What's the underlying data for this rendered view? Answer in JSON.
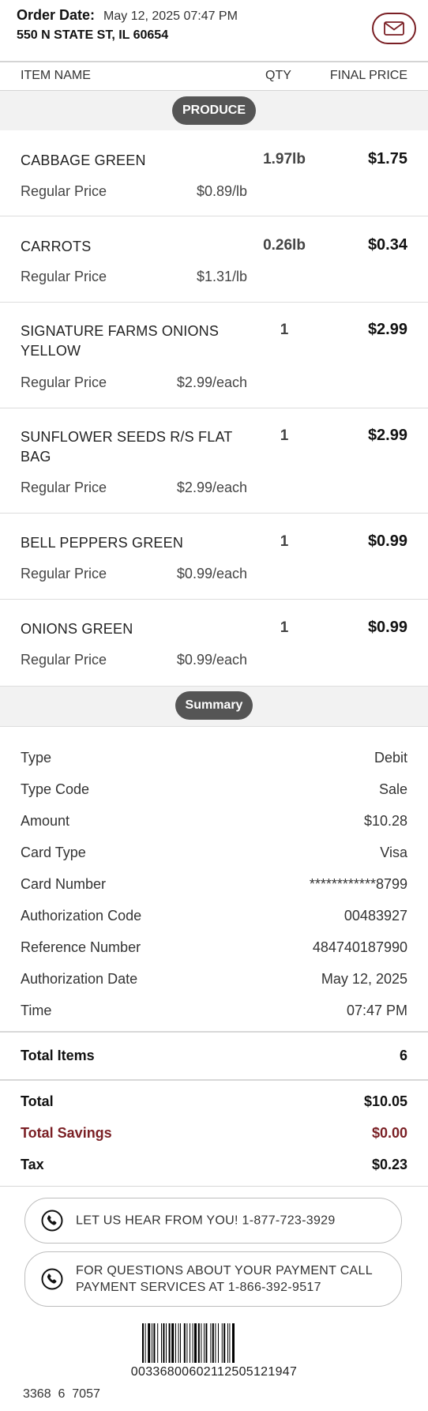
{
  "header": {
    "order_date_label": "Order Date:",
    "order_date_value": "May 12, 2025 07:47 PM",
    "address": "550 N STATE ST, IL 60654",
    "mail_icon": "envelope-icon",
    "accent_color": "#7a1f24"
  },
  "columns": {
    "item_name": "ITEM NAME",
    "qty": "QTY",
    "final_price": "FINAL PRICE"
  },
  "category": {
    "label": "PRODUCE"
  },
  "items": [
    {
      "name": "CABBAGE GREEN",
      "qty": "1.97lb",
      "price": "$1.75",
      "reg_label": "Regular Price",
      "reg_value": "$0.89/lb"
    },
    {
      "name": "CARROTS",
      "qty": "0.26lb",
      "price": "$0.34",
      "reg_label": "Regular Price",
      "reg_value": "$1.31/lb"
    },
    {
      "name": "SIGNATURE FARMS ONIONS YELLOW",
      "qty": "1",
      "price": "$2.99",
      "reg_label": "Regular Price",
      "reg_value": "$2.99/each"
    },
    {
      "name": "SUNFLOWER SEEDS R/S FLAT BAG",
      "qty": "1",
      "price": "$2.99",
      "reg_label": "Regular Price",
      "reg_value": "$2.99/each"
    },
    {
      "name": "BELL PEPPERS GREEN",
      "qty": "1",
      "price": "$0.99",
      "reg_label": "Regular Price",
      "reg_value": "$0.99/each"
    },
    {
      "name": "ONIONS GREEN",
      "qty": "1",
      "price": "$0.99",
      "reg_label": "Regular Price",
      "reg_value": "$0.99/each"
    }
  ],
  "summary": {
    "label": "Summary",
    "rows": [
      {
        "label": "Type",
        "value": "Debit"
      },
      {
        "label": "Type Code",
        "value": "Sale"
      },
      {
        "label": "Amount",
        "value": "$10.28"
      },
      {
        "label": "Card Type",
        "value": "Visa"
      },
      {
        "label": "Card Number",
        "value": "************8799"
      },
      {
        "label": "Authorization Code",
        "value": "00483927"
      },
      {
        "label": "Reference Number",
        "value": "484740187990"
      },
      {
        "label": "Authorization Date",
        "value": "May 12, 2025"
      },
      {
        "label": "Time",
        "value": "07:47 PM"
      }
    ]
  },
  "totals": {
    "total_items_label": "Total Items",
    "total_items_value": "6",
    "total_label": "Total",
    "total_value": "$10.05",
    "savings_label": "Total Savings",
    "savings_value": "$0.00",
    "tax_label": "Tax",
    "tax_value": "$0.23"
  },
  "contacts": [
    {
      "text": "LET US HEAR FROM YOU! 1-877-723-3929",
      "icon": "phone-icon"
    },
    {
      "text": "FOR QUESTIONS ABOUT YOUR PAYMENT CALL PAYMENT SERVICES AT 1-866-392-9517",
      "icon": "phone-icon"
    }
  ],
  "barcode": {
    "number": "0033680060211250512194​7",
    "footer_code": "3368  6  7057"
  }
}
